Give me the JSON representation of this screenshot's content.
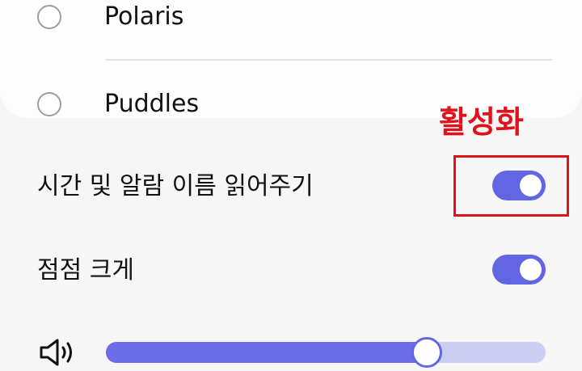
{
  "ringtone_options": [
    {
      "label": "Polaris",
      "selected": false
    },
    {
      "label": "Puddles",
      "selected": false
    }
  ],
  "settings": {
    "read_time_alarm_name": {
      "label": "시간 및 알람 이름 읽어주기",
      "enabled": true
    },
    "gradual_volume": {
      "label": "점점 크게",
      "enabled": true
    }
  },
  "volume": {
    "icon": "speaker-icon",
    "level_fraction": 0.73
  },
  "annotation": {
    "text": "활성화",
    "color": "#e0121b"
  },
  "colors": {
    "accent": "#6366e3",
    "slider_track": "#cccdf3"
  }
}
